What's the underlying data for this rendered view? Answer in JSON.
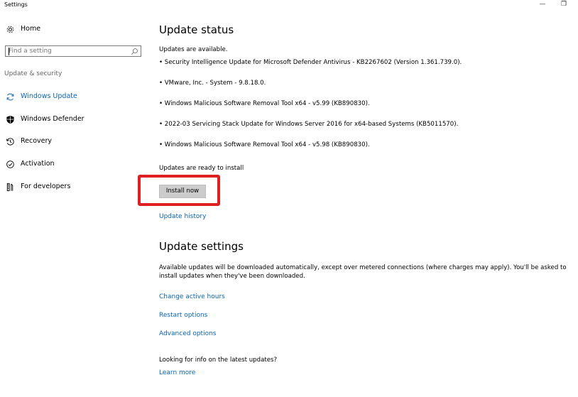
{
  "window": {
    "title": "Settings",
    "minimize_glyph": "—",
    "restore_glyph": "❐"
  },
  "sidebar": {
    "home_label": "Home",
    "search_placeholder": "Find a setting",
    "section_label": "Update & security",
    "items": [
      {
        "label": "Windows Update",
        "icon": "sync-icon",
        "active": true
      },
      {
        "label": "Windows Defender",
        "icon": "shield-icon",
        "active": false
      },
      {
        "label": "Recovery",
        "icon": "history-icon",
        "active": false
      },
      {
        "label": "Activation",
        "icon": "check-circle-icon",
        "active": false
      },
      {
        "label": "For developers",
        "icon": "developer-tools-icon",
        "active": false
      }
    ]
  },
  "update_status": {
    "heading": "Update status",
    "available_text": "Updates are available.",
    "updates": [
      "• Security Intelligence Update for Microsoft Defender Antivirus - KB2267602 (Version 1.361.739.0).",
      "• VMware, Inc. - System - 9.8.18.0.",
      "• Windows Malicious Software Removal Tool x64 - v5.99 (KB890830).",
      "• 2022-03 Servicing Stack Update for Windows Server 2016 for x64-based Systems (KB5011570).",
      "• Windows Malicious Software Removal Tool x64 - v5.98 (KB890830)."
    ],
    "ready_text": "Updates are ready to install",
    "install_button": "Install now",
    "history_link": "Update history"
  },
  "update_settings": {
    "heading": "Update settings",
    "description": "Available updates will be downloaded automatically, except over metered connections (where charges may apply). You'll be asked to install updates when they've been downloaded.",
    "links": [
      "Change active hours",
      "Restart options",
      "Advanced options"
    ]
  },
  "info": {
    "question": "Looking for info on the latest updates?",
    "learn_more": "Learn more"
  },
  "colors": {
    "accent": "#0a64b4",
    "highlight": "#e02020",
    "button_bg": "#cccccc"
  }
}
